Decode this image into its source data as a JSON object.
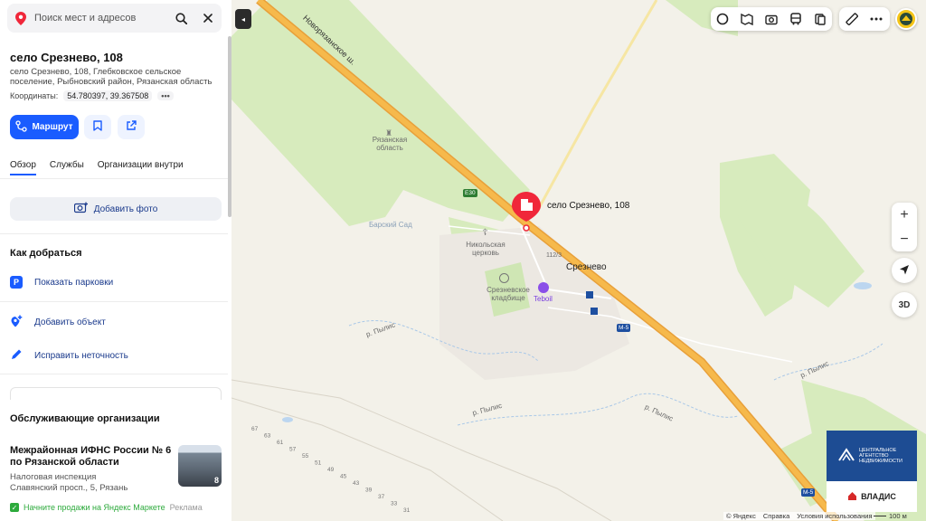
{
  "search": {
    "placeholder": "Поиск мест и адресов"
  },
  "place": {
    "title": "село Срезнево, 108",
    "address": "село Срезнево, 108, Глебковское сельское поселение, Рыбновский район, Рязанская область",
    "coords_label": "Координаты:",
    "coords_value": "54.780397, 39.367508",
    "coords_more": "•••"
  },
  "actions": {
    "route_label": "Маршрут"
  },
  "tabs": [
    "Обзор",
    "Службы",
    "Организации внутри"
  ],
  "add_photo_label": "Добавить фото",
  "how_to_get": {
    "heading": "Как добраться",
    "parking_label": "Показать парковки",
    "parking_badge": "P"
  },
  "edit": {
    "add_object": "Добавить объект",
    "fix_error": "Исправить неточность"
  },
  "services": {
    "heading": "Обслуживающие организации",
    "org_title": "Межрайонная ИФНС России № 6 по Рязанской области",
    "org_category": "Налоговая инспекция",
    "org_address": "Славянский просп., 5, Рязань",
    "org_photo_count": "8"
  },
  "market": {
    "text": "Начните продажи на Яндекс Маркете",
    "ad": "Реклама"
  },
  "map": {
    "marker_title": "село Срезнево, 108",
    "labels": {
      "highway": "Новорязанское ш.",
      "region": "Рязанская область",
      "garden": "Барский Сад",
      "church": "Никольская церковь",
      "cemetery": "Срезневское кладбище",
      "fuel": "Teboil",
      "village": "Срезнево",
      "house": "112/3",
      "river1": "р. Пылис",
      "river2": "р. Пылис",
      "river3": "р. Пылис",
      "river4": "р. Пылис",
      "e30": "E30",
      "m5": "M-5",
      "m5b": "M-5"
    },
    "plot_numbers": [
      "67",
      "63",
      "61",
      "57",
      "55",
      "51",
      "49",
      "45",
      "43",
      "39",
      "37",
      "33",
      "31"
    ],
    "zoom_in": "+",
    "zoom_out": "−",
    "btn_3d": "3D",
    "ad_top": "ЦЕНТРАЛЬНОЕ АГЕНТСТВО НЕДВИЖИМОСТИ",
    "ad_bottom": "ВЛАДИС",
    "copyright": [
      "© Яндекс",
      "Справка",
      "Условия использования"
    ],
    "scale": "100 м"
  },
  "colors": {
    "accent": "#1a5cff",
    "highway": "#f2a93b",
    "forest": "#d6ebb8",
    "marker": "#f0273a"
  }
}
